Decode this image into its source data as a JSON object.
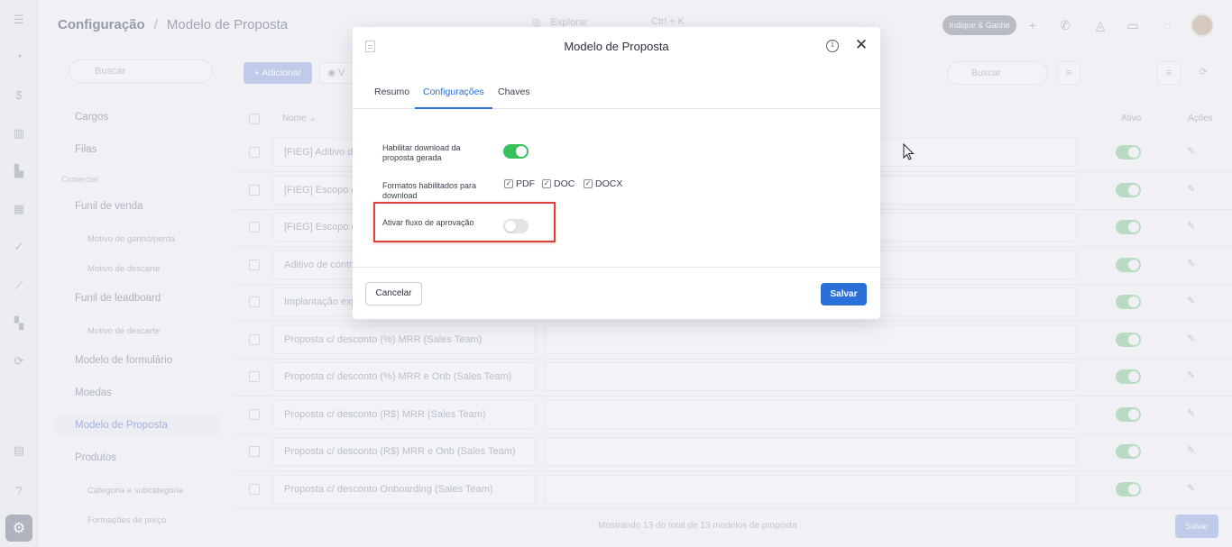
{
  "header": {
    "breadcrumb_root": "Configuração",
    "breadcrumb_sep": "/",
    "breadcrumb_current": "Modelo de Proposta",
    "explore_label": "Explorar",
    "explore_shortcut": "Ctrl + K",
    "promo_button": "Indique & Ganhe"
  },
  "sidebar": {
    "search_placeholder": "Buscar",
    "items": [
      "Cargos",
      "Filas",
      "Comercial",
      "Funil de venda",
      "Motivo de ganho/perda",
      "Motivo de descarte",
      "Funil de leadboard",
      "Motivo de descarte",
      "Modelo de formulário",
      "Moedas",
      "Modelo de Proposta",
      "Produtos",
      "Categoria e subcategoria",
      "Formações de preço"
    ]
  },
  "table": {
    "add_button": "+ Adicionar",
    "view_button": "V",
    "search_placeholder": "Buscar",
    "col_name": "Nome",
    "col_active": "Ativo",
    "col_actions": "Ações",
    "rows": [
      "[FIEG] Aditivo d",
      "[FIEG] Escopo d",
      "[FIEG] Escopo d",
      "Aditivo de contr",
      "Implantação exp",
      "Proposta c/ desconto (%) MRR (Sales Team)",
      "Proposta c/ desconto (%) MRR e Onb (Sales Team)",
      "Proposta c/ desconto (R$) MRR (Sales Team)",
      "Proposta c/ desconto (R$) MRR e Onb (Sales Team)",
      "Proposta c/ desconto Onboarding (Sales Team)"
    ],
    "footer": "Mostrando 13 do total de 13 modelos de proposta",
    "save_button": "Salvar"
  },
  "modal": {
    "title": "Modelo de Proposta",
    "tabs": [
      "Resumo",
      "Configurações",
      "Chaves"
    ],
    "active_tab": "Configurações",
    "field_download": "Habilitar download da proposta gerada",
    "download_enabled": true,
    "field_formats": "Formatos habilitados para download",
    "formats": [
      {
        "label": "PDF",
        "checked": true
      },
      {
        "label": "DOC",
        "checked": true
      },
      {
        "label": "DOCX",
        "checked": true
      }
    ],
    "field_approval": "Ativar fluxo de aprovação",
    "approval_enabled": false,
    "cancel_button": "Cancelar",
    "save_button": "Salvar"
  },
  "colors": {
    "primary": "#2b6fd8",
    "toggle_on": "#35c25b",
    "highlight": "#e0403c"
  }
}
